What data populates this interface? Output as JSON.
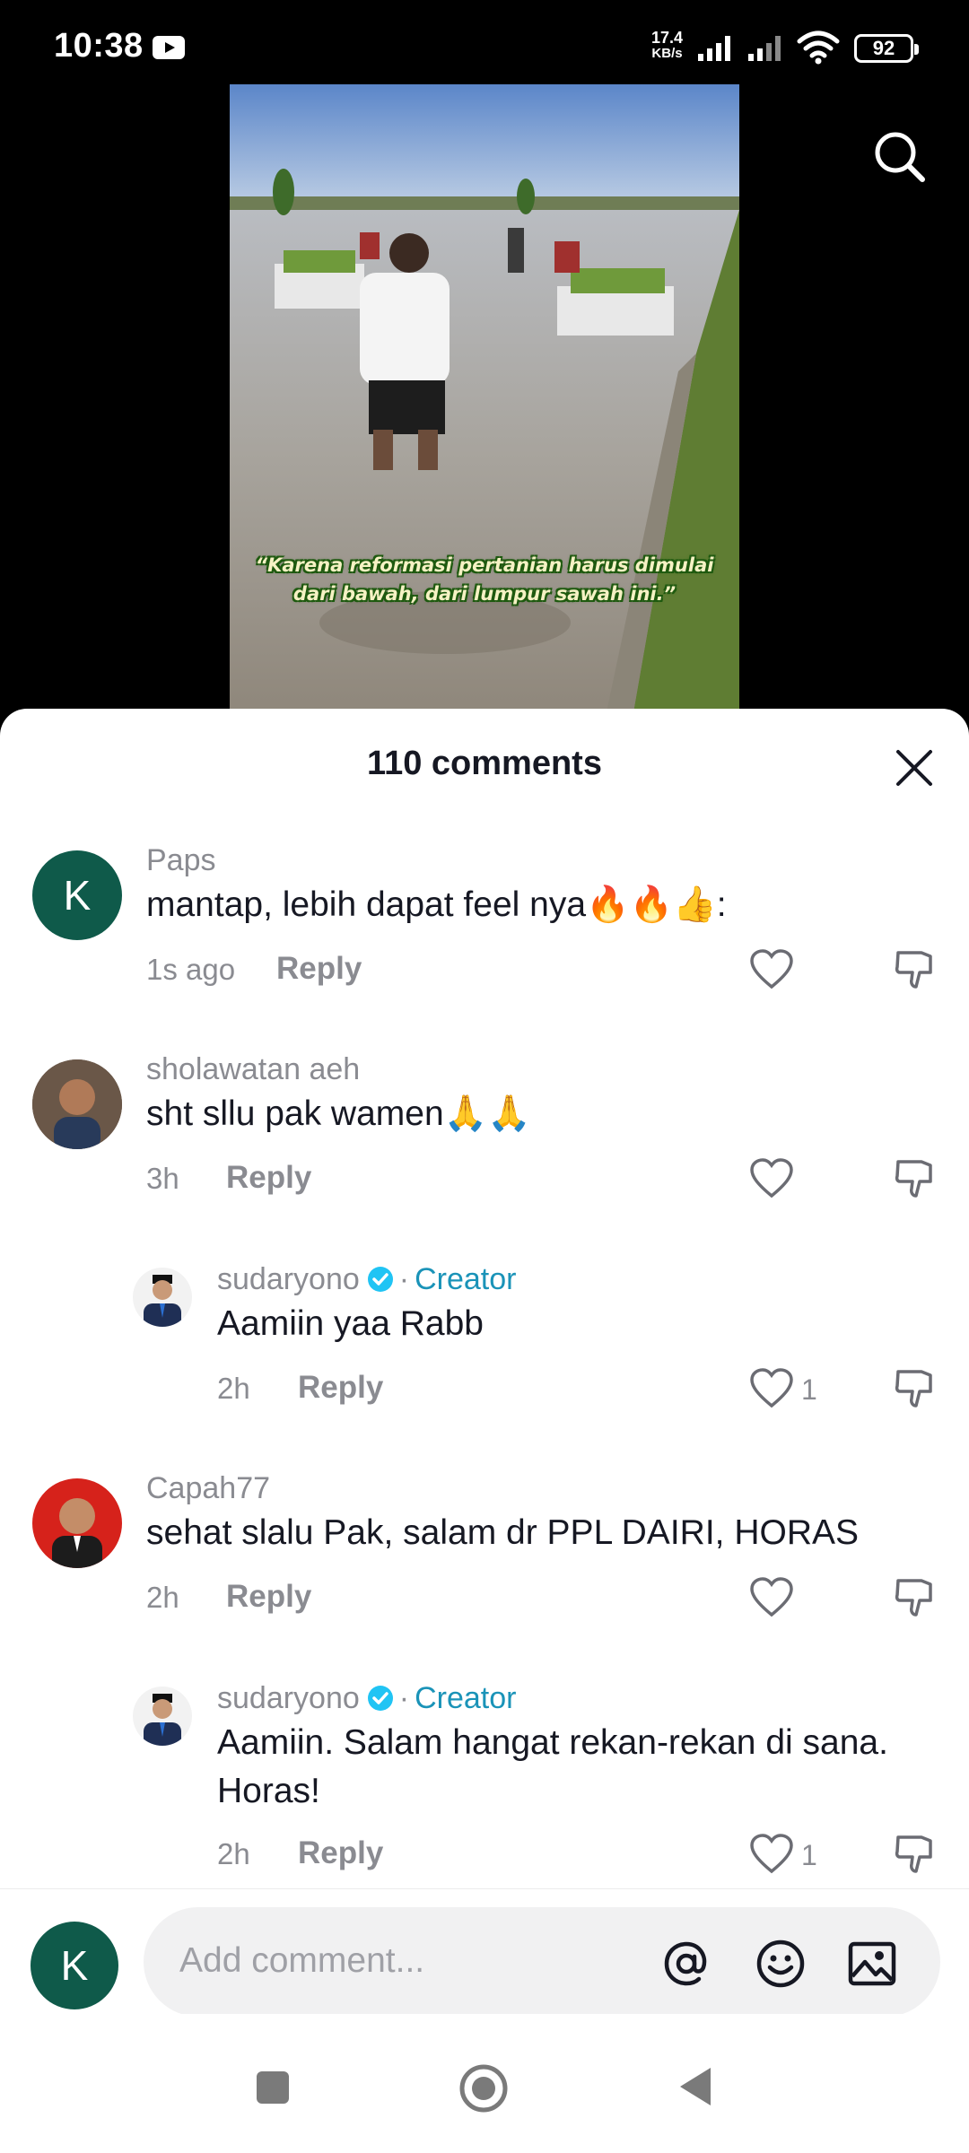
{
  "status_bar": {
    "time": "10:38",
    "net_speed": "17.4",
    "net_unit": "KB/s",
    "battery": "92",
    "icons": [
      "youtube-notification-icon",
      "signal-icon",
      "wifi-icon",
      "battery-icon"
    ]
  },
  "video": {
    "caption_line1": "“Karena reformasi pertanian harus dimulai",
    "caption_line2": "dari bawah, dari lumpur sawah ini.”"
  },
  "comments_panel": {
    "title": "110 comments",
    "comments": [
      {
        "user": "Paps",
        "avatar_letter": "K",
        "text": "mantap, lebih dapat feel nya🔥🔥👍:",
        "time": "1s ago",
        "reply_label": "Reply",
        "likes": ""
      },
      {
        "user": "sholawatan aeh",
        "text": "sht sllu pak wamen🙏🙏",
        "time": "3h",
        "reply_label": "Reply",
        "likes": ""
      },
      {
        "user": "sudaryono",
        "creator_label": "Creator",
        "separator": "·",
        "text": "Aamiin yaa Rabb",
        "time": "2h",
        "reply_label": "Reply",
        "likes": "1"
      },
      {
        "user": "Capah77",
        "text": "sehat slalu Pak, salam dr PPL DAIRI, HORAS",
        "time": "2h",
        "reply_label": "Reply",
        "likes": ""
      },
      {
        "user": "sudaryono",
        "creator_label": "Creator",
        "separator": "·",
        "text_line1": "Aamiin. Salam hangat rekan-rekan di sana.",
        "text_line2": "Horas!",
        "time": "2h",
        "reply_label": "Reply",
        "likes": "1"
      }
    ]
  },
  "input": {
    "avatar_letter": "K",
    "placeholder": "Add comment..."
  },
  "colors": {
    "creator_blue": "#1a93b8",
    "avatar_green": "#0f5a4a",
    "muted_text": "#8a8b91"
  }
}
